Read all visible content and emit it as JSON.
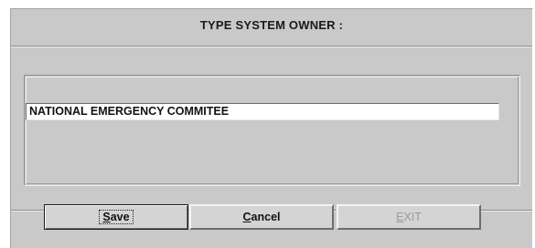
{
  "dialog": {
    "title": "TYPE SYSTEM OWNER :",
    "owner_field": {
      "value": "NATIONAL EMERGENCY COMMITEE"
    },
    "buttons": {
      "save": {
        "mnemonic": "S",
        "rest": "ave"
      },
      "cancel": {
        "mnemonic": "C",
        "rest": "ancel"
      },
      "exit": {
        "mnemonic": "E",
        "rest": "XIT",
        "enabled": false
      }
    }
  }
}
